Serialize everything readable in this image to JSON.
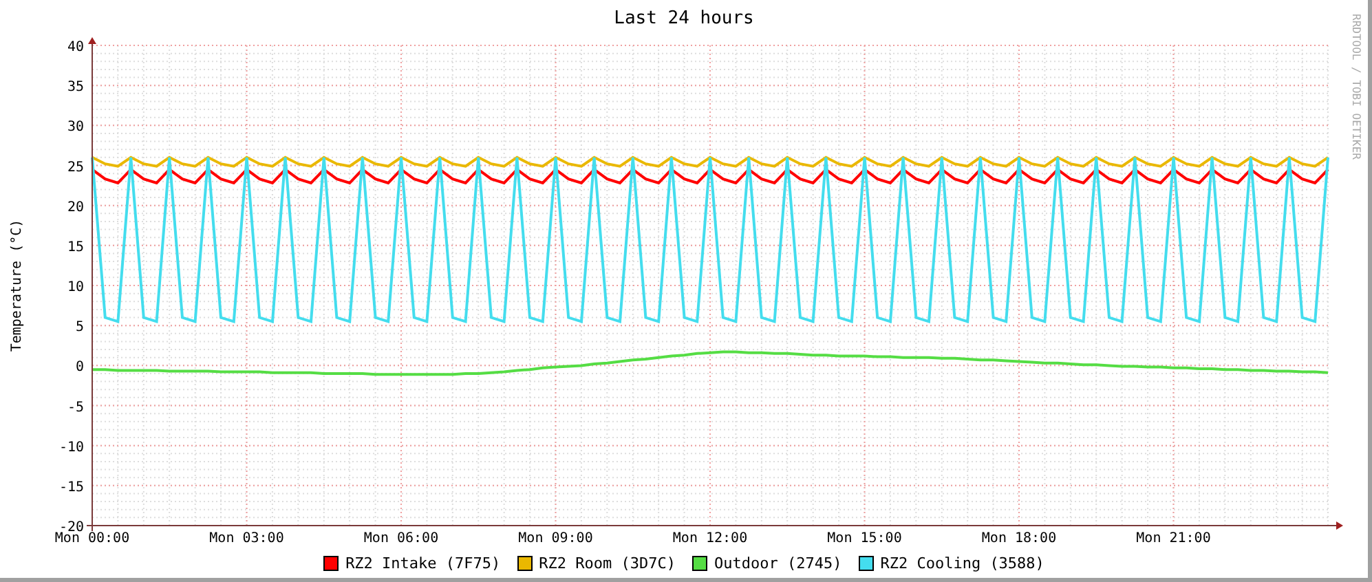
{
  "credit": "RRDTOOL / TOBI OETIKER",
  "chart": {
    "chart_data": {
      "type": "line",
      "title": "Last 24 hours",
      "ylabel": "Temperature (°C)",
      "categories": [
        "Mon 00:00",
        null,
        null,
        null,
        null,
        null,
        null,
        null,
        null,
        null,
        null,
        null,
        "Mon 03:00",
        null,
        null,
        null,
        null,
        null,
        null,
        null,
        null,
        null,
        null,
        null,
        "Mon 06:00",
        null,
        null,
        null,
        null,
        null,
        null,
        null,
        null,
        null,
        null,
        null,
        "Mon 09:00",
        null,
        null,
        null,
        null,
        null,
        null,
        null,
        null,
        null,
        null,
        null,
        "Mon 12:00",
        null,
        null,
        null,
        null,
        null,
        null,
        null,
        null,
        null,
        null,
        null,
        "Mon 15:00",
        null,
        null,
        null,
        null,
        null,
        null,
        null,
        null,
        null,
        null,
        null,
        "Mon 18:00",
        null,
        null,
        null,
        null,
        null,
        null,
        null,
        null,
        null,
        null,
        null,
        "Mon 21:00",
        null,
        null,
        null,
        null,
        null,
        null,
        null,
        null,
        null,
        null,
        null,
        null
      ],
      "series": [
        {
          "name": "RZ2 Intake (7F75)",
          "color": "#ff0000",
          "values": [
            24.5,
            23.3,
            22.8,
            24.5,
            23.3,
            22.8,
            24.5,
            23.3,
            22.8,
            24.5,
            23.3,
            22.8,
            24.5,
            23.3,
            22.8,
            24.5,
            23.3,
            22.8,
            24.5,
            23.3,
            22.8,
            24.5,
            23.3,
            22.8,
            24.5,
            23.3,
            22.8,
            24.5,
            23.3,
            22.8,
            24.5,
            23.3,
            22.8,
            24.5,
            23.3,
            22.8,
            24.5,
            23.3,
            22.8,
            24.5,
            23.3,
            22.8,
            24.5,
            23.3,
            22.8,
            24.5,
            23.3,
            22.8,
            24.5,
            23.3,
            22.8,
            24.5,
            23.3,
            22.8,
            24.5,
            23.3,
            22.8,
            24.5,
            23.3,
            22.8,
            24.5,
            23.3,
            22.8,
            24.5,
            23.3,
            22.8,
            24.5,
            23.3,
            22.8,
            24.5,
            23.3,
            22.8,
            24.5,
            23.3,
            22.8,
            24.5,
            23.3,
            22.8,
            24.5,
            23.3,
            22.8,
            24.5,
            23.3,
            22.8,
            24.5,
            23.3,
            22.8,
            24.5,
            23.3,
            22.8,
            24.5,
            23.3,
            22.8,
            24.5,
            23.3,
            22.8,
            24.5
          ]
        },
        {
          "name": "RZ2 Room (3D7C)",
          "color": "#eab800",
          "values": [
            26,
            25.2,
            24.9,
            26,
            25.2,
            24.9,
            26,
            25.2,
            24.9,
            26,
            25.2,
            24.9,
            26,
            25.2,
            24.9,
            26,
            25.2,
            24.9,
            26,
            25.2,
            24.9,
            26,
            25.2,
            24.9,
            26,
            25.2,
            24.9,
            26,
            25.2,
            24.9,
            26,
            25.2,
            24.9,
            26,
            25.2,
            24.9,
            26,
            25.2,
            24.9,
            26,
            25.2,
            24.9,
            26,
            25.2,
            24.9,
            26,
            25.2,
            24.9,
            26,
            25.2,
            24.9,
            26,
            25.2,
            24.9,
            26,
            25.2,
            24.9,
            26,
            25.2,
            24.9,
            26,
            25.2,
            24.9,
            26,
            25.2,
            24.9,
            26,
            25.2,
            24.9,
            26,
            25.2,
            24.9,
            26,
            25.2,
            24.9,
            26,
            25.2,
            24.9,
            26,
            25.2,
            24.9,
            26,
            25.2,
            24.9,
            26,
            25.2,
            24.9,
            26,
            25.2,
            24.9,
            26,
            25.2,
            24.9,
            26,
            25.2,
            24.9,
            26
          ]
        },
        {
          "name": "Outdoor (2745)",
          "color": "#55dd44",
          "values": [
            -0.5,
            -0.5,
            -0.6,
            -0.6,
            -0.6,
            -0.6,
            -0.7,
            -0.7,
            -0.7,
            -0.7,
            -0.8,
            -0.8,
            -0.8,
            -0.8,
            -0.9,
            -0.9,
            -0.9,
            -0.9,
            -1,
            -1,
            -1,
            -1,
            -1.1,
            -1.1,
            -1.1,
            -1.1,
            -1.1,
            -1.1,
            -1.1,
            -1,
            -1,
            -0.9,
            -0.8,
            -0.6,
            -0.5,
            -0.3,
            -0.2,
            -0.1,
            0,
            0.2,
            0.3,
            0.5,
            0.7,
            0.8,
            1,
            1.2,
            1.3,
            1.5,
            1.6,
            1.7,
            1.7,
            1.6,
            1.6,
            1.5,
            1.5,
            1.4,
            1.3,
            1.3,
            1.2,
            1.2,
            1.2,
            1.1,
            1.1,
            1,
            1,
            1,
            0.9,
            0.9,
            0.8,
            0.7,
            0.7,
            0.6,
            0.5,
            0.4,
            0.3,
            0.3,
            0.2,
            0.1,
            0.1,
            0,
            -0.1,
            -0.1,
            -0.2,
            -0.2,
            -0.3,
            -0.3,
            -0.4,
            -0.4,
            -0.5,
            -0.5,
            -0.6,
            -0.6,
            -0.7,
            -0.7,
            -0.8,
            -0.8,
            -0.9
          ]
        },
        {
          "name": "RZ2 Cooling (3588)",
          "color": "#44ddee",
          "values": [
            26,
            6,
            5.5,
            26,
            6,
            5.5,
            26,
            6,
            5.5,
            26,
            6,
            5.5,
            26,
            6,
            5.5,
            26,
            6,
            5.5,
            26,
            6,
            5.5,
            26,
            6,
            5.5,
            26,
            6,
            5.5,
            26,
            6,
            5.5,
            26,
            6,
            5.5,
            26,
            6,
            5.5,
            26,
            6,
            5.5,
            26,
            6,
            5.5,
            26,
            6,
            5.5,
            26,
            6,
            5.5,
            26,
            6,
            5.5,
            26,
            6,
            5.5,
            26,
            6,
            5.5,
            26,
            6,
            5.5,
            26,
            6,
            5.5,
            26,
            6,
            5.5,
            26,
            6,
            5.5,
            26,
            6,
            5.5,
            26,
            6,
            5.5,
            26,
            6,
            5.5,
            26,
            6,
            5.5,
            26,
            6,
            5.5,
            26,
            6,
            5.5,
            26,
            6,
            5.5,
            26,
            6,
            5.5,
            26,
            6,
            5.5,
            26
          ]
        }
      ],
      "grid": true,
      "ylim": [
        -20,
        40
      ],
      "yticks": [
        -20,
        -15,
        -10,
        -5,
        0,
        5,
        10,
        15,
        20,
        25,
        30,
        35,
        40
      ]
    }
  }
}
